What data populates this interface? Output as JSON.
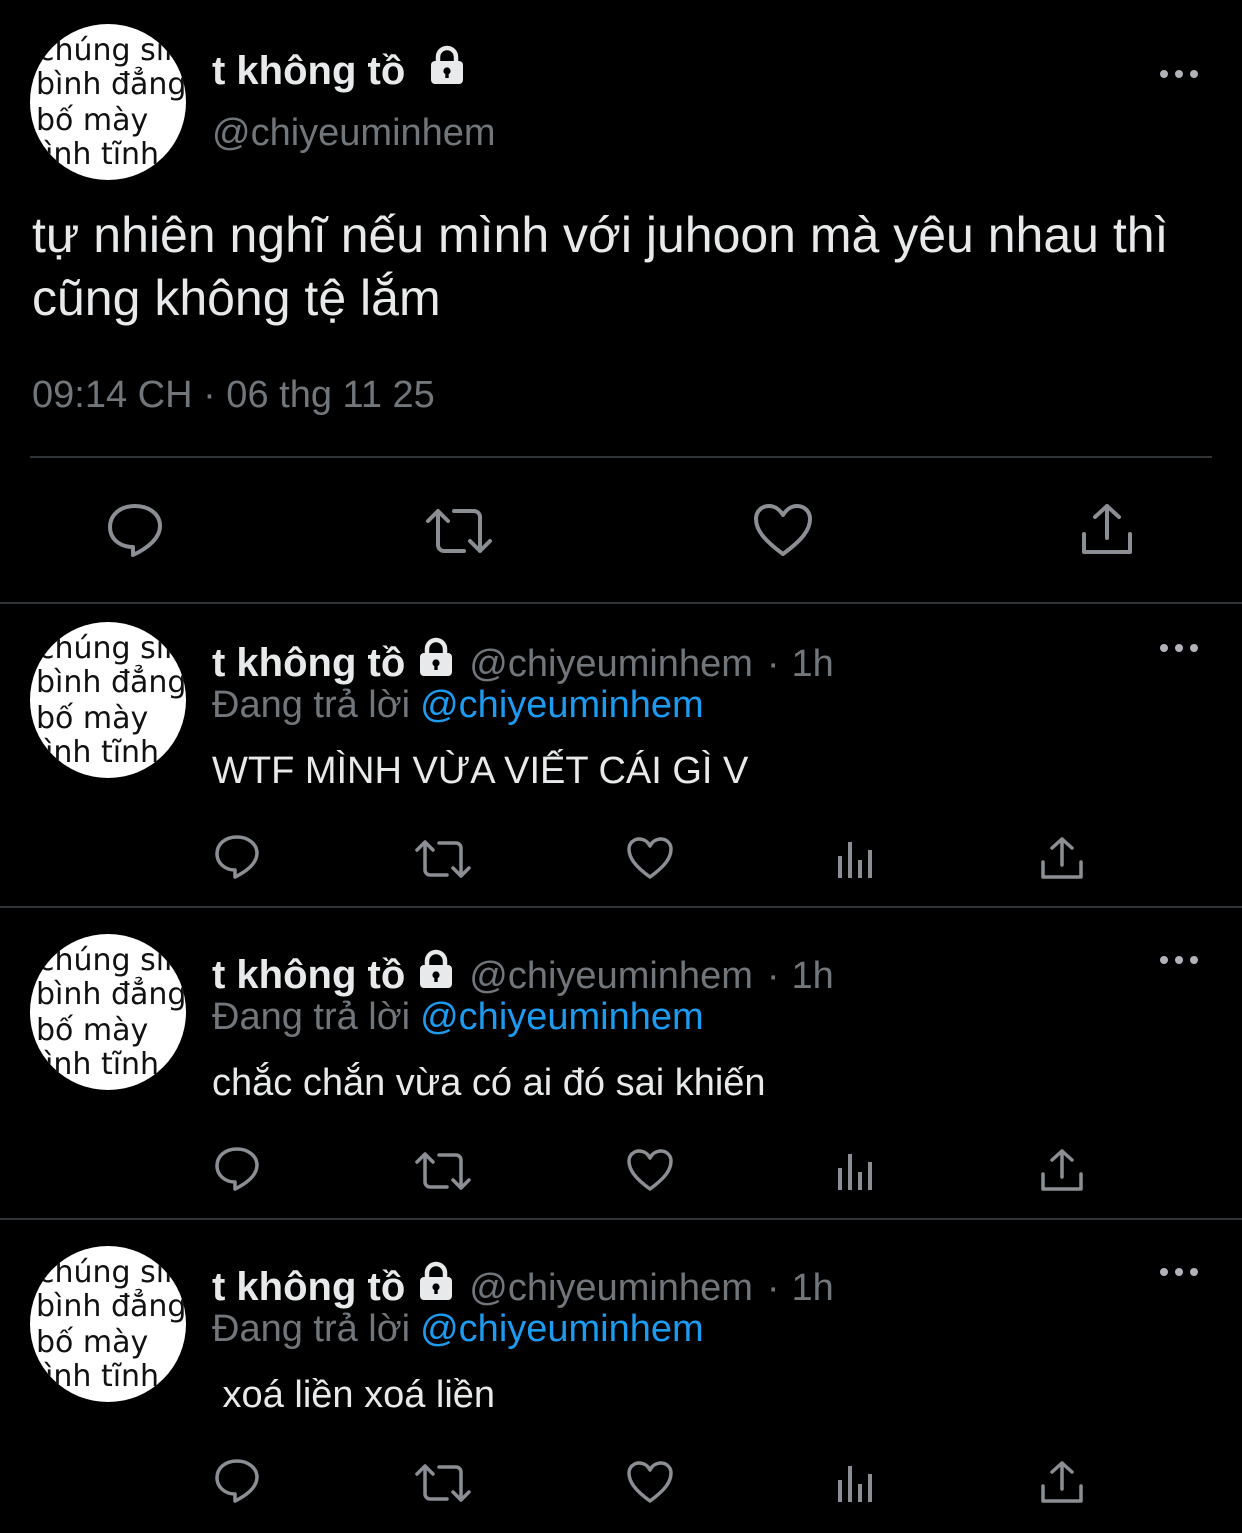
{
  "avatar_text": [
    "chúng sinh",
    "bình đẳng",
    "bố   mày",
    "bình  tĩnh"
  ],
  "main_tweet": {
    "display_name": "t không tồ",
    "handle": "@chiyeuminhem",
    "text": "tự nhiên nghĩ nếu mình với juhoon mà yêu nhau thì cũng không tệ lắm",
    "timestamp": "09:14 CH · 06 thg 11 25"
  },
  "replies": [
    {
      "display_name": "t không tồ",
      "handle": "@chiyeuminhem",
      "time": "1h",
      "replying_prefix": "Đang trả lời",
      "replying_to": "@chiyeuminhem",
      "text": "WTF MÌNH VỪA VIẾT CÁI GÌ V"
    },
    {
      "display_name": "t không tồ",
      "handle": "@chiyeuminhem",
      "time": "1h",
      "replying_prefix": "Đang trả lời",
      "replying_to": "@chiyeuminhem",
      "text": "chắc chắn vừa có ai đó sai khiến"
    },
    {
      "display_name": "t không tồ",
      "handle": "@chiyeuminhem",
      "time": "1h",
      "replying_prefix": "Đang trả lời",
      "replying_to": "@chiyeuminhem",
      "text": " xoá liền xoá liền"
    }
  ],
  "colors": {
    "background": "#000000",
    "text": "#e7e9ea",
    "secondary": "#71767b",
    "link": "#1d9bf0",
    "divider": "#2f3336"
  },
  "icons": [
    "lock-icon",
    "more-icon",
    "reply-icon",
    "retweet-icon",
    "like-icon",
    "views-icon",
    "share-icon"
  ]
}
